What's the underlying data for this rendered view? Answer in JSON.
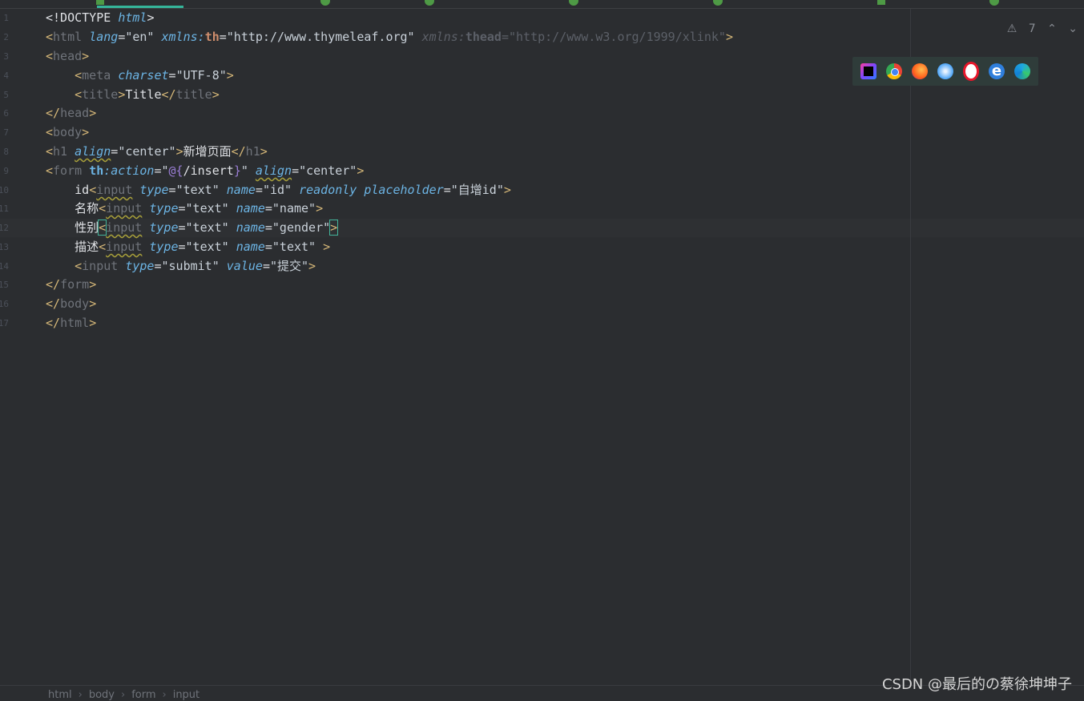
{
  "editor": {
    "line_numbers": [
      "1",
      "2",
      "3",
      "4",
      "5",
      "6",
      "7",
      "8",
      "9",
      "10",
      "11",
      "12",
      "13",
      "14",
      "15",
      "16",
      "17"
    ],
    "code": {
      "l1": {
        "text": "<!DOCTYPE ",
        "kw": "html",
        "close": ">"
      },
      "l2": {
        "tag": "html",
        "a1": "lang",
        "v1": "\"en\"",
        "ns": "xmlns:",
        "nsn": "th",
        "v2": "\"http://www.thymeleaf.org\"",
        "ns2": "xmlns:",
        "nsn2": "thead",
        "v3": "\"http://www.w3.org/1999/xlink\""
      },
      "l3": {
        "tag": "head"
      },
      "l4": {
        "tag": "meta",
        "a1": "charset",
        "v1": "\"UTF-8\""
      },
      "l5": {
        "tag": "title",
        "txt": "Title",
        "endtag": "title"
      },
      "l6": {
        "tag": "head"
      },
      "l7": {
        "tag": "body"
      },
      "l8": {
        "tag": "h1",
        "a1": "align",
        "v1": "\"center\"",
        "txt": "新增页面",
        "endtag": "h1"
      },
      "l9": {
        "tag": "form",
        "ns": "th",
        "a1": ":action",
        "v1a": "\"",
        "expr_open": "@{",
        "expr_path": "/insert",
        "expr_close": "}",
        "v1b": "\"",
        "a2": "align",
        "v2": "\"center\""
      },
      "l10": {
        "lbl": "id",
        "tag": "input",
        "a1": "type",
        "v1": "\"text\"",
        "a2": "name",
        "v2": "\"id\"",
        "a3": "readonly",
        "a4": "placeholder",
        "v4": "\"自增id\""
      },
      "l11": {
        "lbl": "名称",
        "tag": "input",
        "a1": "type",
        "v1": "\"text\"",
        "a2": "name",
        "v2": "\"name\""
      },
      "l12": {
        "lbl": "性别",
        "tag": "input",
        "a1": "type",
        "v1": "\"text\"",
        "a2": "name",
        "v2": "\"gender\""
      },
      "l13": {
        "lbl": "描述",
        "tag": "input",
        "a1": "type",
        "v1": "\"text\"",
        "a2": "name",
        "v2": "\"text\""
      },
      "l14": {
        "tag": "input",
        "a1": "type",
        "v1": "\"submit\"",
        "a2": "value",
        "v2": "\"提交\""
      },
      "l15": {
        "tag": "form"
      },
      "l16": {
        "tag": "body"
      },
      "l17": {
        "tag": "html"
      }
    },
    "inspection_count": "7"
  },
  "browser_icons": [
    "intellij-icon",
    "chrome-icon",
    "firefox-icon",
    "safari-icon",
    "opera-icon",
    "ie-icon",
    "edge-icon"
  ],
  "breadcrumb": [
    "html",
    "body",
    "form",
    "input"
  ],
  "watermark": "CSDN @最后的の蔡徐坤坤子"
}
